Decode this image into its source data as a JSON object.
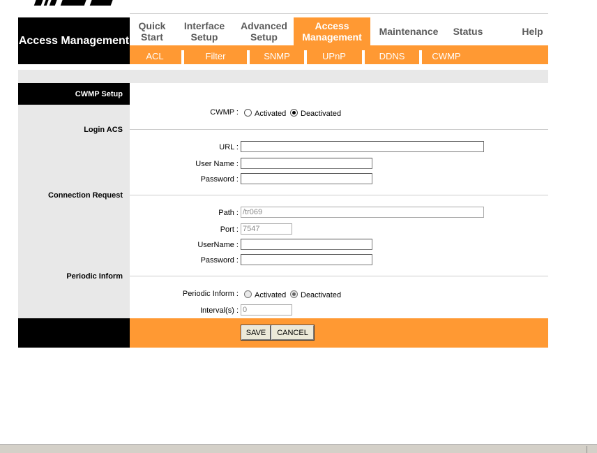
{
  "brand": {
    "logo": "MSI",
    "color": "#000000"
  },
  "colors": {
    "accent": "#ff9933",
    "header_bg": "#000000",
    "panel_bg": "#e8e8e8"
  },
  "section_title": "Access Management",
  "main_nav": [
    {
      "label": "Quick Start",
      "active": false
    },
    {
      "label": "Interface Setup",
      "active": false
    },
    {
      "label": "Advanced Setup",
      "active": false
    },
    {
      "label": "Access Management",
      "active": true
    },
    {
      "label": "Maintenance",
      "active": false
    },
    {
      "label": "Status",
      "active": false
    },
    {
      "label": "Help",
      "active": false
    }
  ],
  "sub_nav": [
    "ACL",
    "Filter",
    "SNMP",
    "UPnP",
    "DDNS",
    "CWMP"
  ],
  "form": {
    "heading": "CWMP Setup",
    "cwmp": {
      "label": "CWMP :",
      "activated": "Activated",
      "deactivated": "Deactivated",
      "selected": "Deactivated"
    },
    "login_acs": {
      "section": "Login ACS",
      "url_label": "URL :",
      "url_value": "",
      "username_label": "User Name :",
      "username_value": "",
      "password_label": "Password :",
      "password_value": ""
    },
    "connection_request": {
      "section": "Connection Request",
      "path_label": "Path :",
      "path_value": "/tr069",
      "port_label": "Port :",
      "port_value": "7547",
      "username_label": "UserName :",
      "username_value": "",
      "password_label": "Password :",
      "password_value": ""
    },
    "periodic_inform": {
      "section": "Periodic Inform",
      "inform_label": "Periodic Inform :",
      "activated": "Activated",
      "deactivated": "Deactivated",
      "selected": "Deactivated",
      "interval_label": "Interval(s) :",
      "interval_value": "0"
    },
    "buttons": {
      "save": "SAVE",
      "cancel": "CANCEL"
    }
  }
}
